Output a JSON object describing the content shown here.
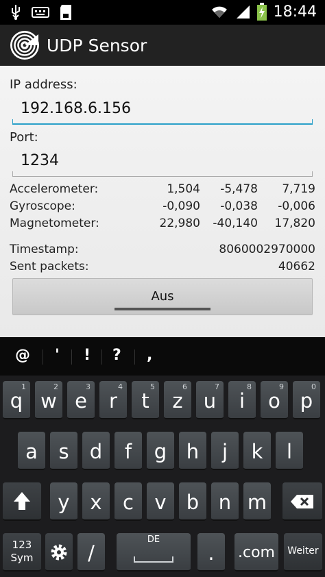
{
  "status_bar": {
    "time": "18:44",
    "icons": [
      "usb-icon",
      "keyboard-icon",
      "sd-card-icon",
      "wifi-icon",
      "signal-icon",
      "battery-charging-icon"
    ]
  },
  "app": {
    "title": "UDP Sensor",
    "icon": "udp-sensor-app-icon"
  },
  "form": {
    "ip_label": "IP address:",
    "ip_value": "192.168.6.156",
    "port_label": "Port:",
    "port_value": "1234"
  },
  "sensors": [
    {
      "name": "Accelerometer:",
      "x": "1,504",
      "y": "-5,478",
      "z": "7,719"
    },
    {
      "name": "Gyroscope:",
      "x": "-0,090",
      "y": "-0,038",
      "z": "-0,006"
    },
    {
      "name": "Magnetometer:",
      "x": "22,980",
      "y": "-40,140",
      "z": "17,820"
    }
  ],
  "stats": {
    "timestamp_label": "Timestamp:",
    "timestamp_value": "8060002970000",
    "sent_label": "Sent packets:",
    "sent_value": "40662"
  },
  "toggle_button": {
    "label": "Aus"
  },
  "keyboard": {
    "suggestions": [
      "@",
      "'",
      "!",
      "?",
      ","
    ],
    "row1": [
      {
        "ch": "q",
        "num": "1"
      },
      {
        "ch": "w",
        "num": "2"
      },
      {
        "ch": "e",
        "num": "3"
      },
      {
        "ch": "r",
        "num": "4"
      },
      {
        "ch": "t",
        "num": "5"
      },
      {
        "ch": "z",
        "num": "6"
      },
      {
        "ch": "u",
        "num": "7"
      },
      {
        "ch": "i",
        "num": "8"
      },
      {
        "ch": "o",
        "num": "9"
      },
      {
        "ch": "p",
        "num": "0"
      }
    ],
    "row2": [
      "a",
      "s",
      "d",
      "f",
      "g",
      "h",
      "j",
      "k",
      "l"
    ],
    "row3": [
      "y",
      "x",
      "c",
      "v",
      "b",
      "n",
      "m"
    ],
    "sym_label": "123\nSym",
    "sym_line1": "123",
    "sym_line2": "Sym",
    "slash": "/",
    "lang": "DE",
    "period": ".",
    "dotcom": ".com",
    "enter": "Weiter"
  }
}
